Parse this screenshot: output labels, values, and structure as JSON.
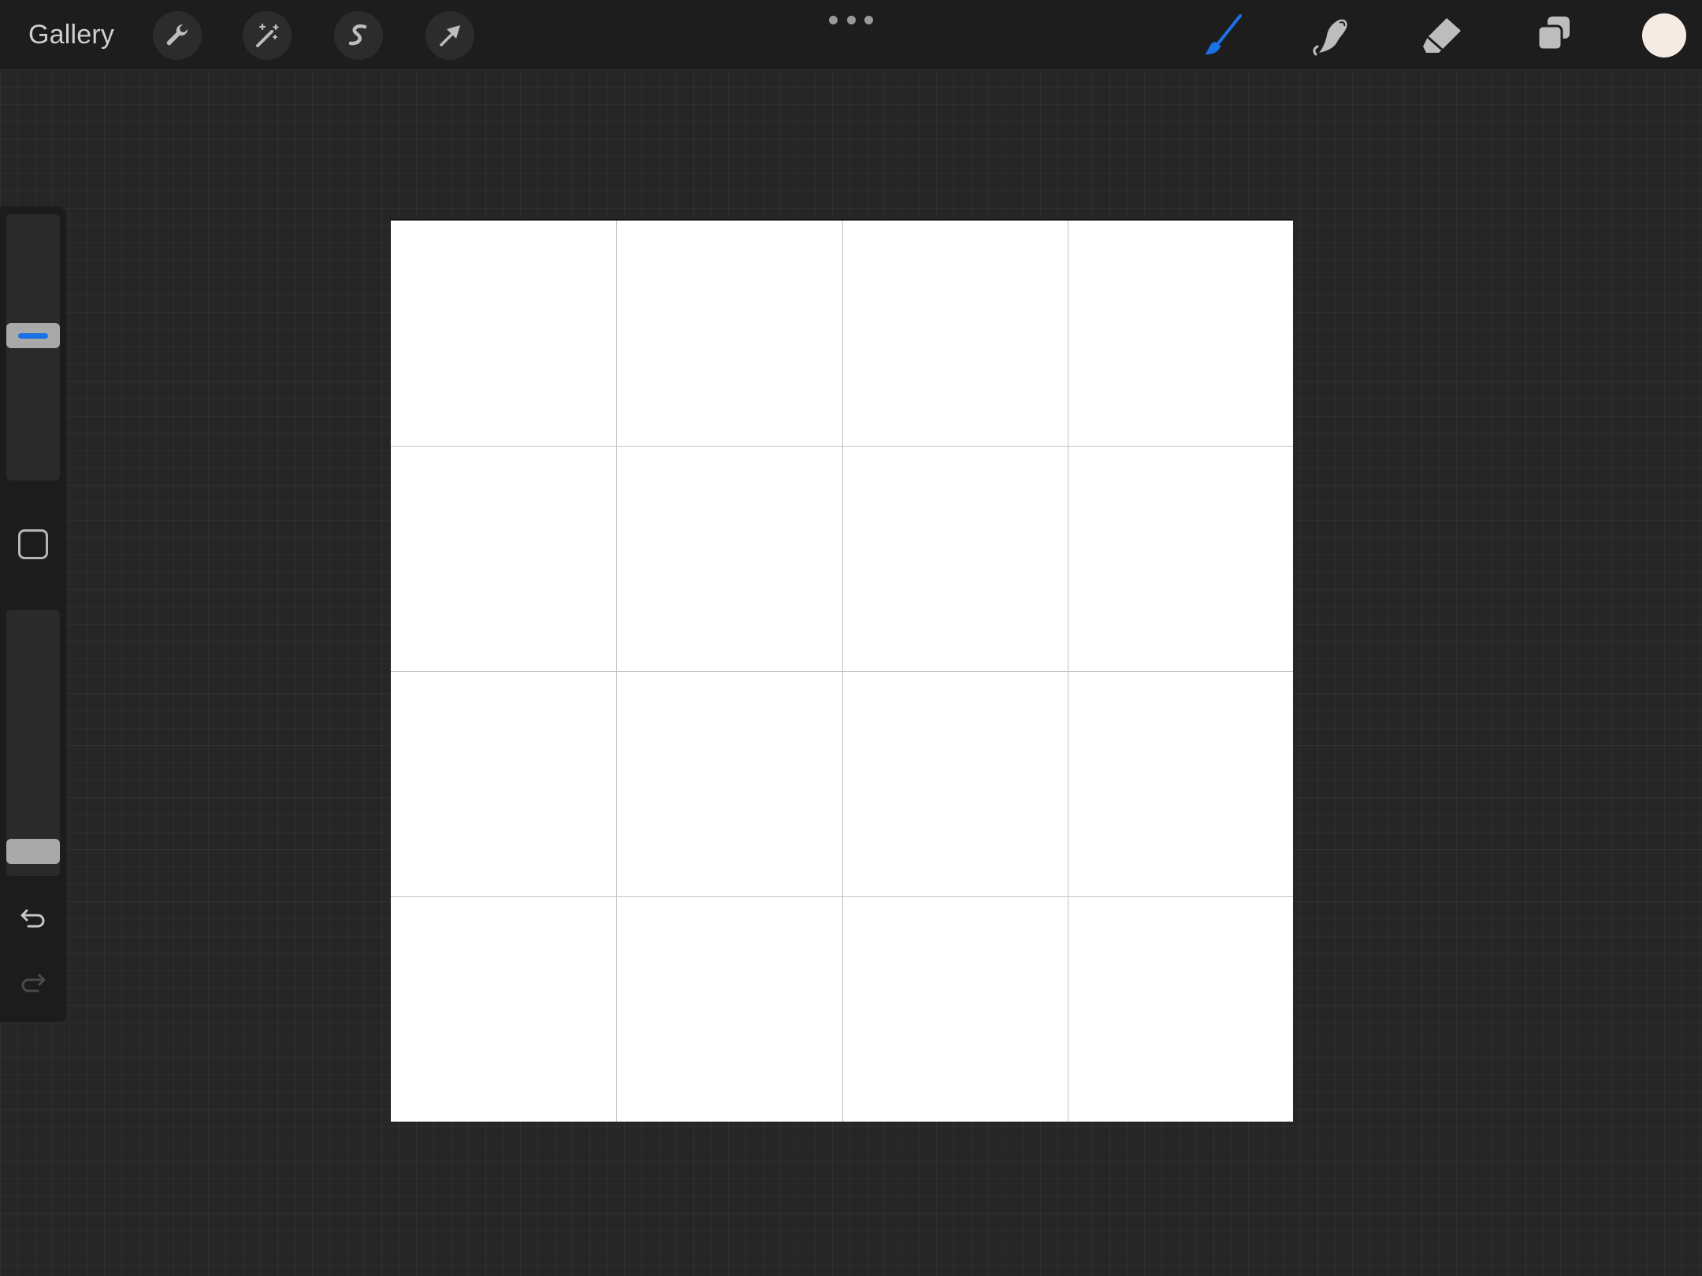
{
  "toolbar": {
    "gallery_label": "Gallery",
    "left_tools": [
      {
        "name": "actions",
        "icon": "wrench-icon"
      },
      {
        "name": "adjustments",
        "icon": "magic-wand-icon"
      },
      {
        "name": "selection",
        "icon": "selection-s-icon"
      },
      {
        "name": "transform",
        "icon": "arrow-cursor-icon"
      }
    ],
    "more_icon": "ellipsis-icon",
    "right_tools": [
      {
        "name": "brush",
        "icon": "brush-icon",
        "active": true
      },
      {
        "name": "smudge",
        "icon": "smudge-finger-icon",
        "active": false
      },
      {
        "name": "eraser",
        "icon": "eraser-icon",
        "active": false
      },
      {
        "name": "layers",
        "icon": "layers-icon",
        "active": false
      }
    ],
    "current_color": "#f6ebe3",
    "active_color": "#1a72e6",
    "inactive_icon_color": "#bdbdbd"
  },
  "sidebar": {
    "brush_size_level": 0.55,
    "opacity_level": 0.05,
    "modify_button_icon": "square-icon",
    "undo_icon": "undo-icon",
    "redo_icon": "redo-icon",
    "redo_enabled": false
  },
  "canvas": {
    "background": "#ffffff",
    "grid_columns": 4,
    "grid_rows": 4,
    "grid_color": "#c4c4c4"
  }
}
